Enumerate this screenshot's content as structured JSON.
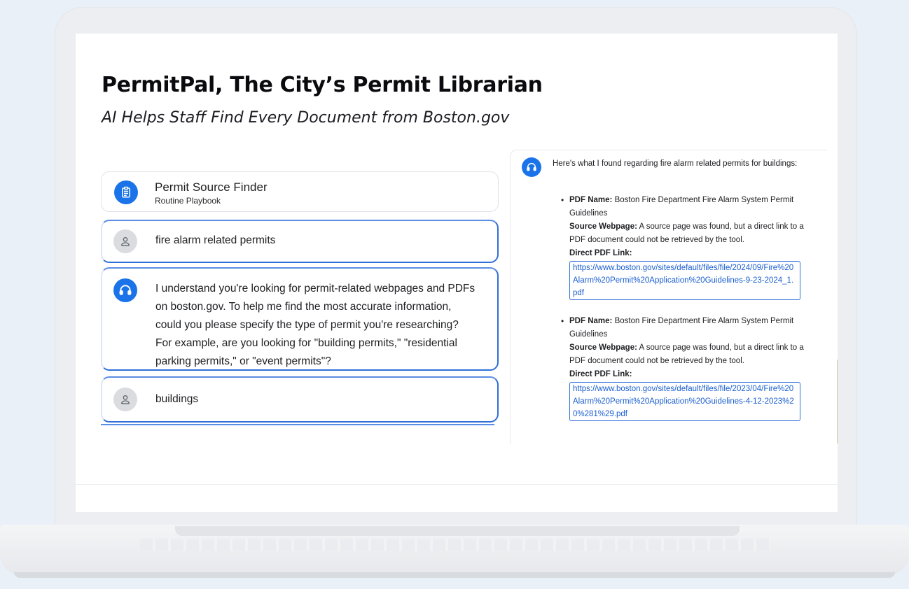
{
  "title": "PermitPal, The City’s Permit Librarian",
  "subtitle": "AI Helps Staff Find Every Document from Boston.gov",
  "finder": {
    "name": "Permit Source Finder",
    "subtitle": "Routine Playbook",
    "icon": "clipboard-icon"
  },
  "conversation": [
    {
      "role": "user",
      "icon": "person-icon",
      "text": "fire alarm related permits"
    },
    {
      "role": "bot",
      "icon": "headset-icon",
      "text": "I understand you're looking for permit-related webpages and PDFs on boston.gov. To help me find the most accurate information, could you please specify the type of permit you're researching? For example, are you looking for \"building permits,\" \"residential parking permits,\" or \"event permits\"?"
    },
    {
      "role": "user",
      "icon": "person-icon",
      "text": "buildings"
    }
  ],
  "response": {
    "icon": "headset-icon",
    "intro": "Here's what I found regarding fire alarm related permits for buildings:",
    "results": [
      {
        "pdf_name_label": "PDF Name:",
        "pdf_name": "Boston Fire Department Fire Alarm System Permit Guidelines",
        "source_label": "Source Webpage:",
        "source": "A source page was found, but a direct link to a PDF document could not be retrieved by the tool.",
        "link_label": "Direct PDF Link:",
        "link": "https://www.boston.gov/sites/default/files/file/2024/09/Fire%20Alarm%20Permit%20Application%20Guidelines-9-23-2024_1.pdf"
      },
      {
        "pdf_name_label": "PDF Name:",
        "pdf_name": "Boston Fire Department Fire Alarm System Permit Guidelines",
        "source_label": "Source Webpage:",
        "source": "A source page was found, but a direct link to a PDF document could not be retrieved by the tool.",
        "link_label": "Direct PDF Link:",
        "link": "https://www.boston.gov/sites/default/files/file/2023/04/Fire%20Alarm%20Permit%20Application%20Guidelines-4-12-2023%20%281%29.pdf"
      }
    ]
  },
  "colors": {
    "accent": "#1a73e8",
    "border_blue": "#2f6fd8",
    "user_avatar": "#dadce0"
  }
}
